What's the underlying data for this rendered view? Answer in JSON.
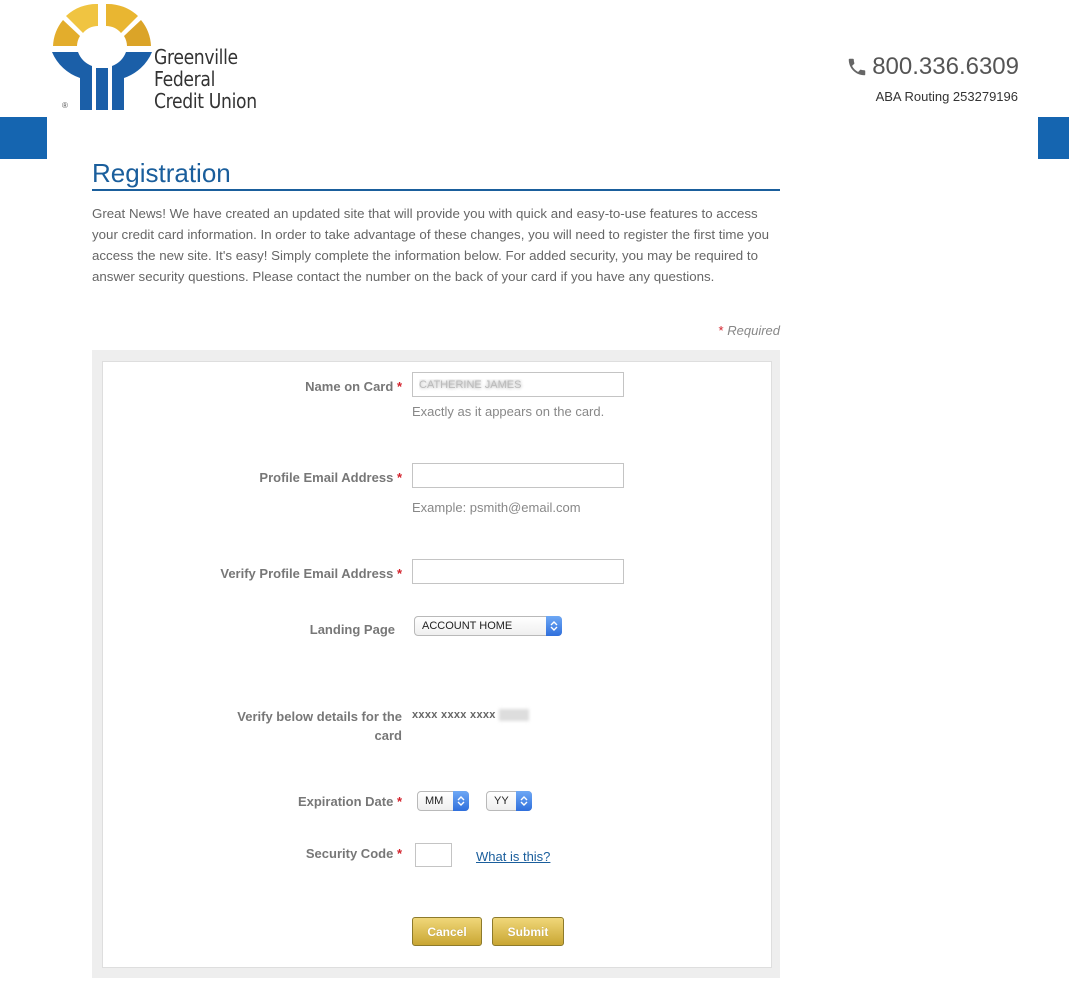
{
  "header": {
    "logo_lines": [
      "Greenville",
      "Federal",
      "Credit Union"
    ],
    "registered_mark": "®",
    "phone": "800.336.6309",
    "phone_icon": "phone-icon",
    "routing": "ABA Routing 253279196"
  },
  "colors": {
    "brand_blue": "#1565b0",
    "title_blue": "#1a5e9c",
    "logo_gold": "#e8b93a",
    "button_gold": "#d7b544",
    "required_red": "#d3212b"
  },
  "page": {
    "title": "Registration",
    "intro": "Great News! We have created an updated site that will provide you with quick and easy-to-use features to access your credit card information. In order to take advantage of these changes, you will need to register the first time you access the new site. It's easy! Simply complete the information below. For added security, you may be required to answer security questions. Please contact the number on the back of your card if you have any questions.",
    "required_star": "*",
    "required_label": "Required"
  },
  "form": {
    "name_on_card": {
      "label": "Name on Card",
      "value": "CATHERINE JAMES",
      "hint": "Exactly as it appears on the card."
    },
    "email": {
      "label": "Profile Email Address",
      "value": "",
      "hint": "Example: psmith@email.com"
    },
    "verify_email": {
      "label": "Verify Profile Email Address",
      "value": ""
    },
    "landing_page": {
      "label": "Landing Page",
      "selected": "ACCOUNT HOME"
    },
    "verify_card": {
      "label": "Verify below details for the card",
      "masked_number": "xxxx xxxx xxxx"
    },
    "expiration": {
      "label": "Expiration Date",
      "month": "MM",
      "year": "YY"
    },
    "security_code": {
      "label": "Security Code",
      "value": "",
      "help_link": "What is this?"
    },
    "buttons": {
      "cancel": "Cancel",
      "submit": "Submit"
    }
  }
}
